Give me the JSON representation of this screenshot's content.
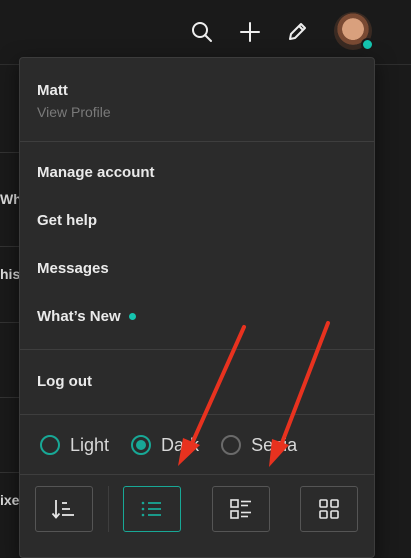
{
  "header": {
    "icons": [
      "search-icon",
      "plus-icon",
      "pencil-icon"
    ],
    "status_color": "#15c5b0"
  },
  "background_fragments": [
    "Wh",
    "his",
    "ixe"
  ],
  "menu": {
    "profile": {
      "name": "Matt",
      "link": "View Profile"
    },
    "items": [
      {
        "label": "Manage account"
      },
      {
        "label": "Get help"
      },
      {
        "label": "Messages"
      },
      {
        "label": "What’s New",
        "new_indicator": true
      }
    ],
    "logout_label": "Log out",
    "themes": [
      {
        "label": "Light",
        "selected": false
      },
      {
        "label": "Dark",
        "selected": true
      },
      {
        "label": "Sepia",
        "selected": false
      }
    ],
    "view_modes": [
      {
        "icon": "sort-icon",
        "active": false
      },
      {
        "icon": "list-icon",
        "active": true
      },
      {
        "icon": "compact-list-icon",
        "active": false
      },
      {
        "icon": "grid-icon",
        "active": false
      }
    ]
  },
  "colors": {
    "accent": "#18a896",
    "annotation": "#e8321f"
  }
}
